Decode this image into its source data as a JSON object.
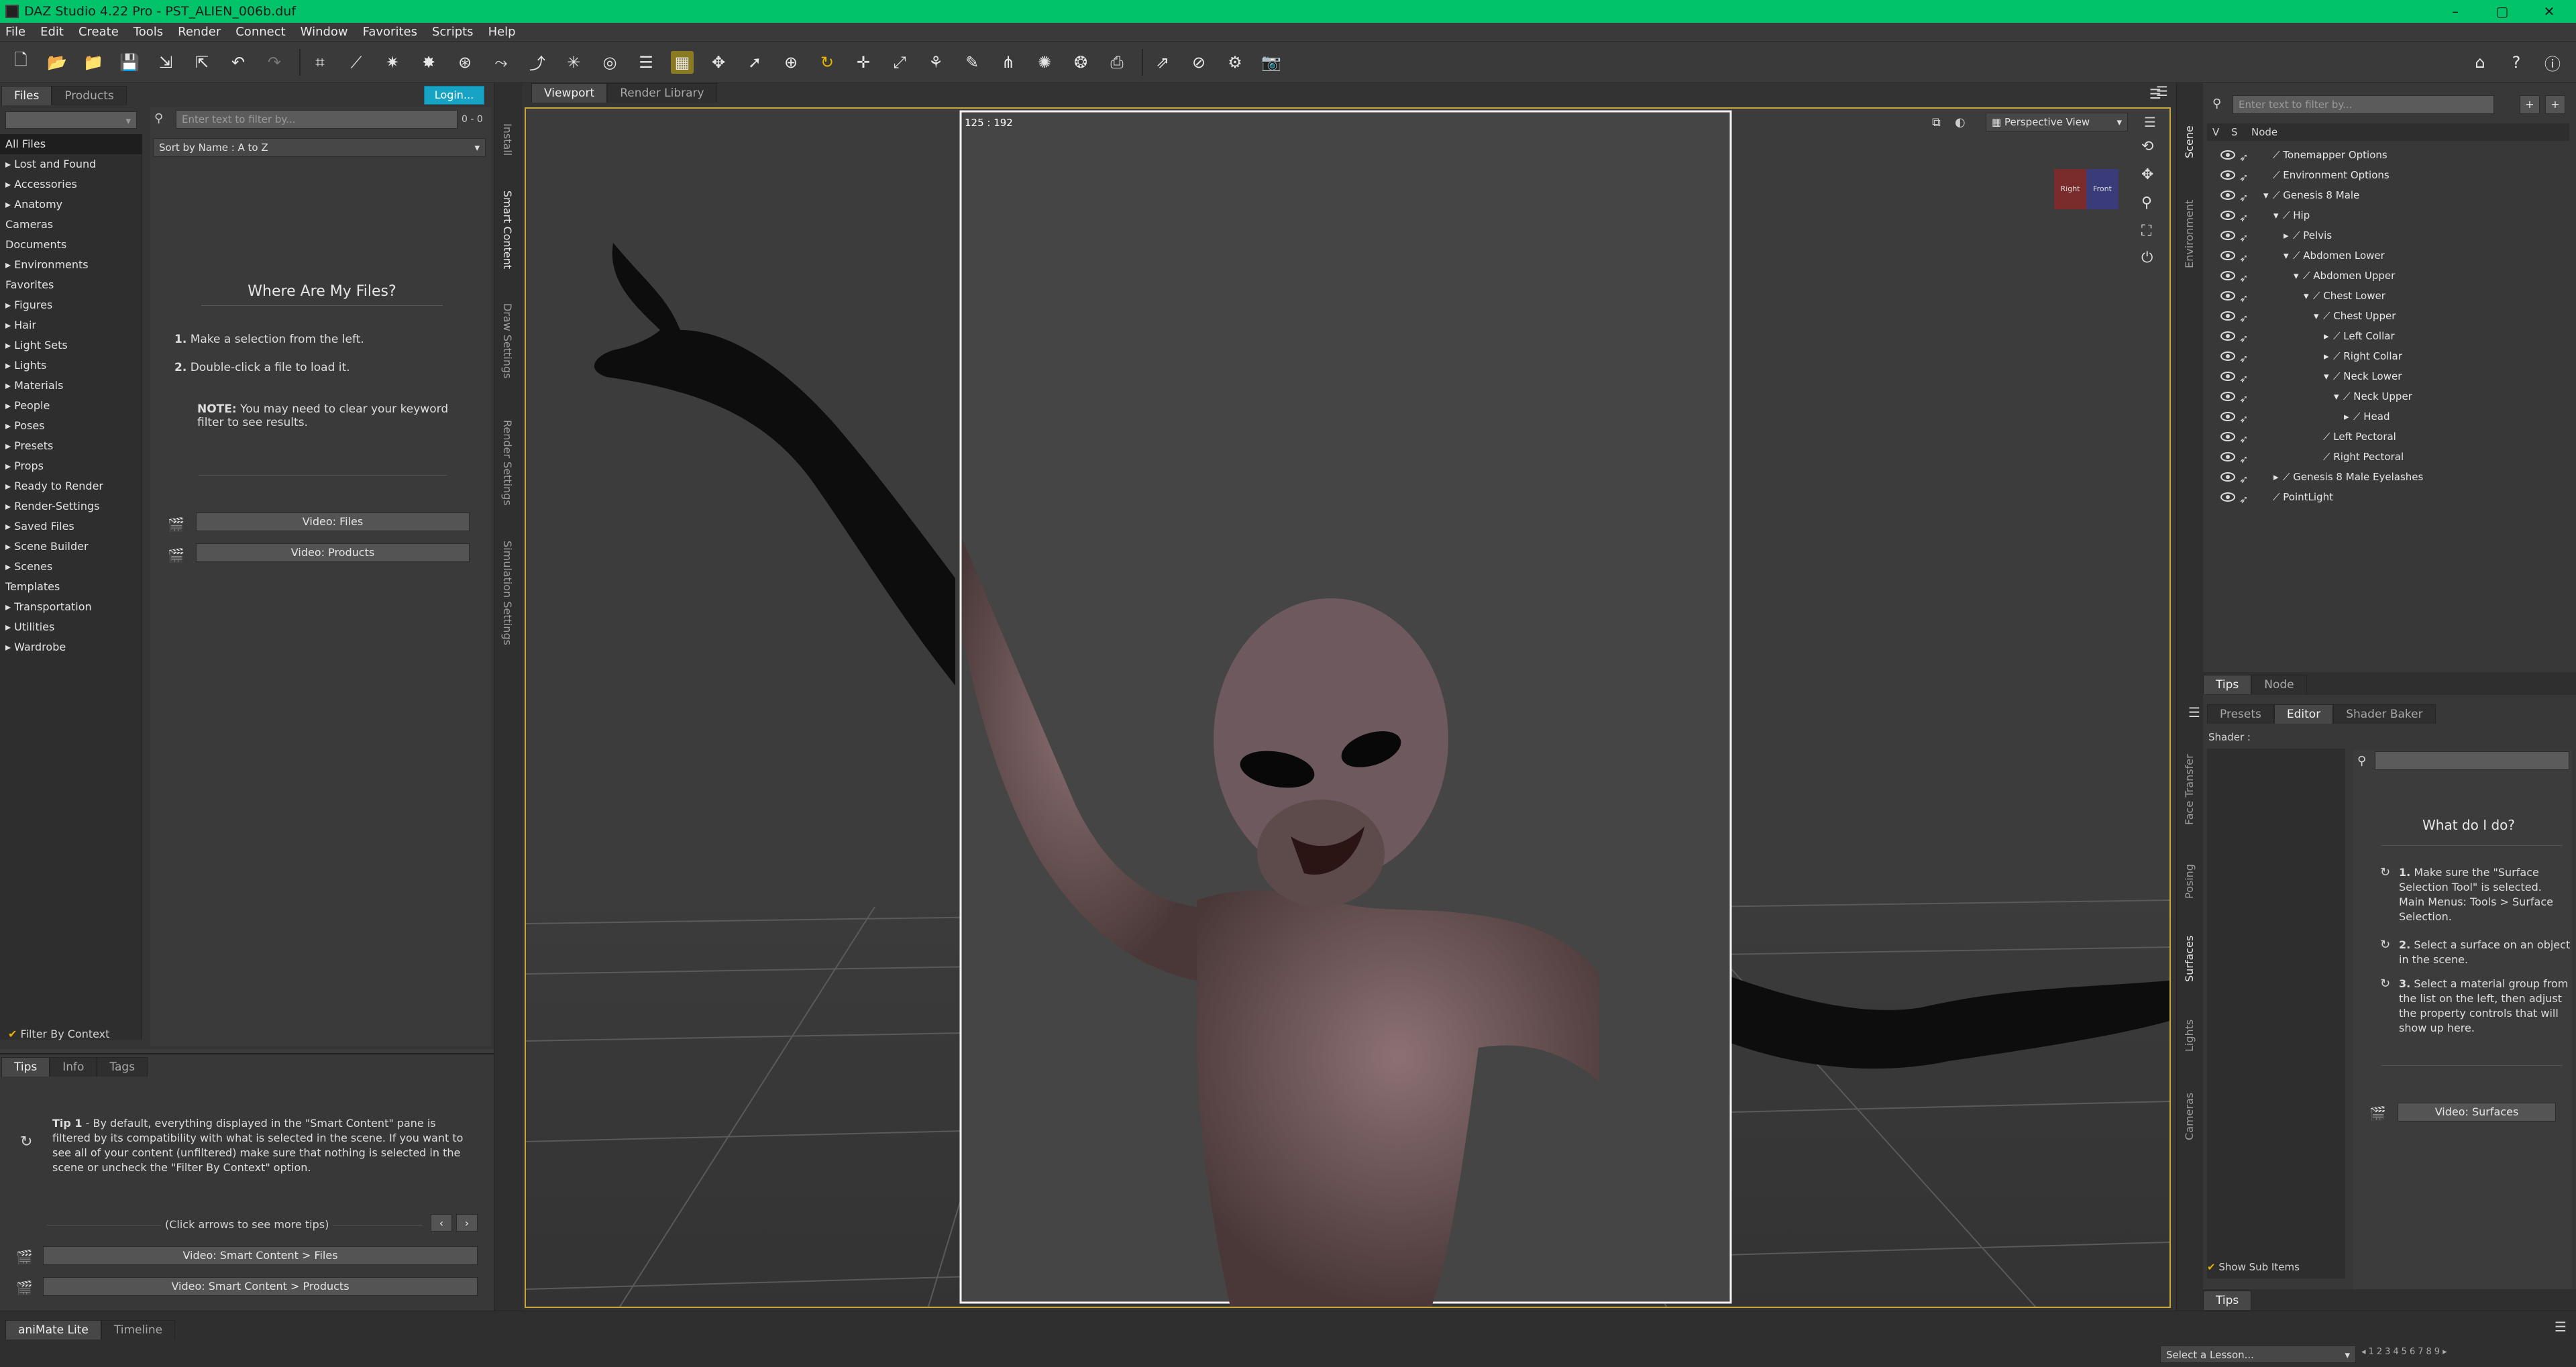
{
  "window": {
    "title": "DAZ Studio 4.22 Pro - PST_ALIEN_006b.duf",
    "min": "–",
    "max": "▢",
    "close": "✕"
  },
  "menu": [
    "File",
    "Edit",
    "Create",
    "Tools",
    "Render",
    "Connect",
    "Window",
    "Favorites",
    "Scripts",
    "Help"
  ],
  "left": {
    "tabs": [
      "Files",
      "Products"
    ],
    "login": "Login...",
    "search_placeholder": "Enter text to filter by...",
    "count": "0 - 0",
    "sort": "Sort by Name : A to Z",
    "categories": [
      {
        "label": "All Files",
        "arrow": ""
      },
      {
        "label": "Lost and Found",
        "arrow": "▸"
      },
      {
        "label": "Accessories",
        "arrow": "▸"
      },
      {
        "label": "Anatomy",
        "arrow": "▸"
      },
      {
        "label": "Cameras",
        "arrow": ""
      },
      {
        "label": "Documents",
        "arrow": ""
      },
      {
        "label": "Environments",
        "arrow": "▸"
      },
      {
        "label": "Favorites",
        "arrow": ""
      },
      {
        "label": "Figures",
        "arrow": "▸"
      },
      {
        "label": "Hair",
        "arrow": "▸"
      },
      {
        "label": "Light Sets",
        "arrow": "▸"
      },
      {
        "label": "Lights",
        "arrow": "▸"
      },
      {
        "label": "Materials",
        "arrow": "▸"
      },
      {
        "label": "People",
        "arrow": "▸"
      },
      {
        "label": "Poses",
        "arrow": "▸"
      },
      {
        "label": "Presets",
        "arrow": "▸"
      },
      {
        "label": "Props",
        "arrow": "▸"
      },
      {
        "label": "Ready to Render",
        "arrow": "▸"
      },
      {
        "label": "Render-Settings",
        "arrow": "▸"
      },
      {
        "label": "Saved Files",
        "arrow": "▸"
      },
      {
        "label": "Scene Builder",
        "arrow": "▸"
      },
      {
        "label": "Scenes",
        "arrow": "▸"
      },
      {
        "label": "Templates",
        "arrow": ""
      },
      {
        "label": "Transportation",
        "arrow": "▸"
      },
      {
        "label": "Utilities",
        "arrow": "▸"
      },
      {
        "label": "Wardrobe",
        "arrow": "▸"
      }
    ],
    "filter_context": "Filter By Context",
    "where_title": "Where Are My Files?",
    "step1_num": "1.",
    "step1": "Make a selection from the left.",
    "step2_num": "2.",
    "step2": "Double-click a file to load it.",
    "note_label": "NOTE:",
    "note": "You may need to clear your keyword filter to see results.",
    "video_files": "Video: Files",
    "video_products": "Video:  Products",
    "side_tabs": [
      "Install",
      "Smart Content",
      "Draw Settings",
      "Render Settings",
      "Simulation Settings"
    ],
    "tips_tabs": [
      "Tips",
      "Info",
      "Tags"
    ],
    "tip_label": "Tip 1",
    "tip": " - By default, everything displayed in the \"Smart Content\" pane is filtered by its compatibility with what is selected in the scene. If you want to see all of your content (unfiltered) make sure that nothing is selected in the scene or uncheck the \"Filter By Context\" option.",
    "more_tips": "(Click arrows to see more tips)",
    "video_sc_files": "Video: Smart Content > Files",
    "video_sc_products": "Video: Smart Content > Products"
  },
  "viewport": {
    "tabs": [
      "Viewport",
      "Render Library"
    ],
    "frame_label": "125 : 192",
    "view": "Perspective View",
    "cube_left": "Right",
    "cube_right": "Front"
  },
  "scene": {
    "search_placeholder": "Enter text to filter by...",
    "col_v": "V",
    "col_s": "S",
    "col_node": "Node",
    "nodes": [
      {
        "label": "Tonemapper Options",
        "indent": 0,
        "arrow": ""
      },
      {
        "label": "Environment Options",
        "indent": 0,
        "arrow": ""
      },
      {
        "label": "Genesis 8 Male",
        "indent": 0,
        "arrow": "▾"
      },
      {
        "label": "Hip",
        "indent": 1,
        "arrow": "▾"
      },
      {
        "label": "Pelvis",
        "indent": 2,
        "arrow": "▸"
      },
      {
        "label": "Abdomen Lower",
        "indent": 2,
        "arrow": "▾"
      },
      {
        "label": "Abdomen Upper",
        "indent": 3,
        "arrow": "▾"
      },
      {
        "label": "Chest Lower",
        "indent": 4,
        "arrow": "▾"
      },
      {
        "label": "Chest Upper",
        "indent": 5,
        "arrow": "▾"
      },
      {
        "label": "Left Collar",
        "indent": 6,
        "arrow": "▸"
      },
      {
        "label": "Right Collar",
        "indent": 6,
        "arrow": "▸"
      },
      {
        "label": "Neck Lower",
        "indent": 6,
        "arrow": "▾"
      },
      {
        "label": "Neck Upper",
        "indent": 7,
        "arrow": "▾"
      },
      {
        "label": "Head",
        "indent": 8,
        "arrow": "▸"
      },
      {
        "label": "Left Pectoral",
        "indent": 5,
        "arrow": ""
      },
      {
        "label": "Right Pectoral",
        "indent": 5,
        "arrow": ""
      },
      {
        "label": "Genesis 8 Male Eyelashes",
        "indent": 1,
        "arrow": "▸"
      },
      {
        "label": "PointLight",
        "indent": 0,
        "arrow": ""
      }
    ],
    "right_tabs_top": [
      "Scene",
      "Environment"
    ],
    "bottom_tabs": [
      "Tips",
      "Node"
    ]
  },
  "surfaces": {
    "tabs": [
      "Presets",
      "Editor",
      "Shader Baker"
    ],
    "shader_label": "Shader :",
    "what_title": "What do I do?",
    "step1_num": "1.",
    "step1": "Make sure the \"Surface Selection Tool\" is selected. Main Menus: Tools > Surface Selection.",
    "step2_num": "2.",
    "step2": "Select a surface on an object in the scene.",
    "step3_num": "3.",
    "step3": "Select a material group from the list on the left, then adjust the property controls that will show up here.",
    "video": "Video: Surfaces",
    "show_sub": "Show Sub Items",
    "tips_tab": "Tips",
    "side_tabs": [
      "Face Transfer",
      "Posing",
      "Surfaces",
      "Lights",
      "Cameras"
    ]
  },
  "bottom": {
    "tabs": [
      "aniMate Lite",
      "Timeline"
    ],
    "lesson": "Select a Lesson...",
    "pages": [
      "1",
      "2",
      "3",
      "4",
      "5",
      "6",
      "7",
      "8",
      "9"
    ]
  },
  "colors": {
    "titlebar": "#00c36a",
    "accent": "#c8a83a",
    "login": "#16a3c4"
  }
}
